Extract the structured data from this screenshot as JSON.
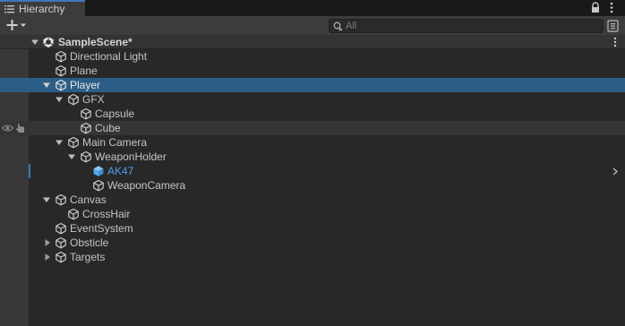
{
  "tab": {
    "label": "Hierarchy"
  },
  "search": {
    "placeholder": "All"
  },
  "scene": {
    "label": "SampleScene*"
  },
  "rows": [
    {
      "label": "Directional Light"
    },
    {
      "label": "Plane"
    },
    {
      "label": "Player"
    },
    {
      "label": "GFX"
    },
    {
      "label": "Capsule"
    },
    {
      "label": "Cube"
    },
    {
      "label": "Main Camera"
    },
    {
      "label": "WeaponHolder"
    },
    {
      "label": "AK47"
    },
    {
      "label": "WeaponCamera"
    },
    {
      "label": "Canvas"
    },
    {
      "label": "CrossHair"
    },
    {
      "label": "EventSystem"
    },
    {
      "label": "Obsticle"
    },
    {
      "label": "Targets"
    }
  ],
  "colors": {
    "selection": "#2c5d87",
    "prefab_text": "#4c9ee8",
    "accent": "#3a79bb"
  },
  "icons": [
    "list-icon",
    "lock-icon",
    "menu-dots-icon",
    "plus-icon",
    "search-icon",
    "unity-scene-icon",
    "gameobject-cube-icon",
    "prefab-cube-icon",
    "eye-icon",
    "pick-hand-icon"
  ]
}
